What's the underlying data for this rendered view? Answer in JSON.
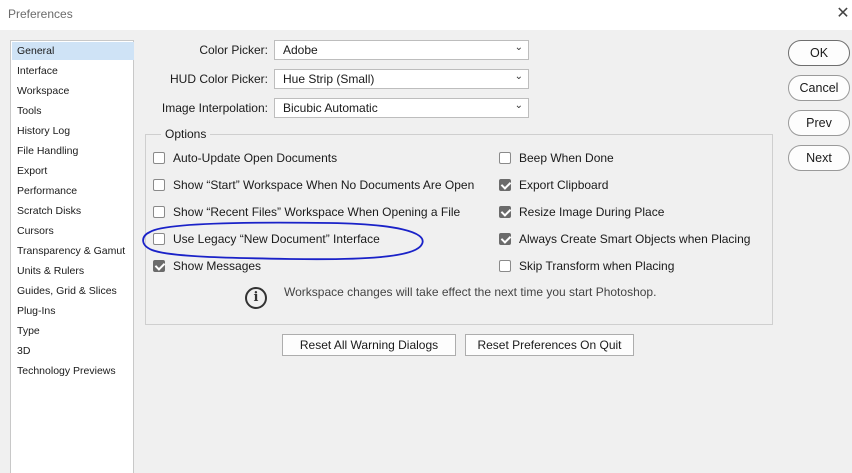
{
  "window": {
    "title": "Preferences",
    "close_glyph": "✕"
  },
  "sidebar": {
    "items": [
      {
        "label": "General",
        "selected": true
      },
      {
        "label": "Interface"
      },
      {
        "label": "Workspace"
      },
      {
        "label": "Tools"
      },
      {
        "label": "History Log"
      },
      {
        "label": "File Handling"
      },
      {
        "label": "Export"
      },
      {
        "label": "Performance"
      },
      {
        "label": "Scratch Disks"
      },
      {
        "label": "Cursors"
      },
      {
        "label": "Transparency & Gamut"
      },
      {
        "label": "Units & Rulers"
      },
      {
        "label": "Guides, Grid & Slices"
      },
      {
        "label": "Plug-Ins"
      },
      {
        "label": "Type"
      },
      {
        "label": "3D"
      },
      {
        "label": "Technology Previews"
      }
    ]
  },
  "fields": {
    "color_picker": {
      "label": "Color Picker:",
      "value": "Adobe"
    },
    "hud_color_picker": {
      "label": "HUD Color Picker:",
      "value": "Hue Strip (Small)"
    },
    "image_interpolation": {
      "label": "Image Interpolation:",
      "value": "Bicubic Automatic"
    }
  },
  "options": {
    "legend": "Options",
    "left": [
      {
        "label": "Auto-Update Open Documents",
        "checked": false
      },
      {
        "label": "Show “Start” Workspace When No Documents Are Open",
        "checked": false
      },
      {
        "label": "Show “Recent Files” Workspace When Opening a File",
        "checked": false
      },
      {
        "label": "Use Legacy “New Document” Interface",
        "checked": false
      },
      {
        "label": "Show Messages",
        "checked": true
      }
    ],
    "right": [
      {
        "label": "Beep When Done",
        "checked": false
      },
      {
        "label": "Export Clipboard",
        "checked": true
      },
      {
        "label": "Resize Image During Place",
        "checked": true
      },
      {
        "label": "Always Create Smart Objects when Placing",
        "checked": true
      },
      {
        "label": "Skip Transform when Placing",
        "checked": false
      }
    ],
    "info_icon": "info-circle-icon",
    "info_glyph": "i",
    "info_text": "Workspace changes will take effect the next time you start Photoshop."
  },
  "bottom_buttons": {
    "reset_warnings": "Reset All Warning Dialogs",
    "reset_on_quit": "Reset Preferences On Quit"
  },
  "side_buttons": {
    "ok": "OK",
    "cancel": "Cancel",
    "prev": "Prev",
    "next": "Next"
  },
  "colors": {
    "selection": "#cfe3f6",
    "annotation": "#1a22c8",
    "checked": "#6b6b6b"
  }
}
